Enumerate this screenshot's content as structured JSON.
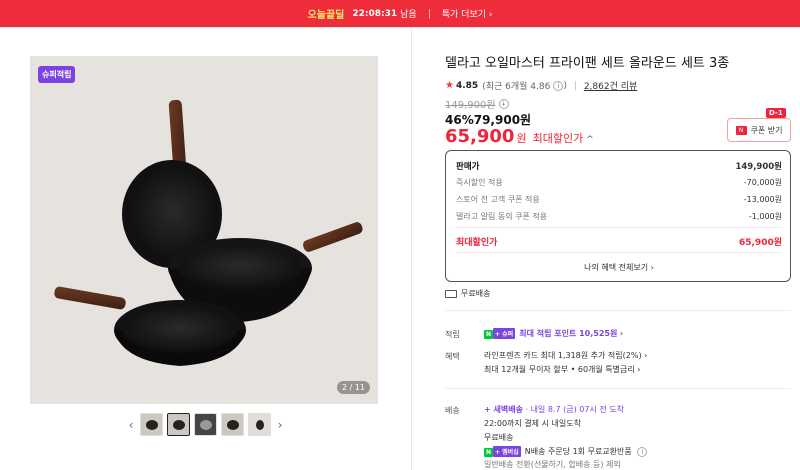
{
  "topbar": {
    "deal_label": "오늘끝딜",
    "timer": "22:08:31",
    "timer_suffix": "남음",
    "more_label": "특가 더보기 ›"
  },
  "gallery": {
    "badge": "슈퍼적립",
    "counter": "2 / 11",
    "prev_icon": "chevron-left-icon",
    "next_icon": "chevron-right-icon"
  },
  "product": {
    "title": "델라고 오일마스터 프라이팬 세트 올라운드 세트 3종",
    "rating": "4.85",
    "rating_sub": "(최근 6개월 4.86",
    "rating_sub_close": ")",
    "reviews": "2,862건 리뷰",
    "original_price": "149,900원",
    "discount_rate": "46%",
    "sale_price": "79,900원",
    "max_price": "65,900",
    "max_unit": "원",
    "max_label": "최대할인가",
    "coupon_label": "쿠폰 받기",
    "coupon_dday": "D-1"
  },
  "breakdown": {
    "rows": [
      {
        "k": "판매가",
        "v": "149,900원"
      },
      {
        "k": "즉시할인 적용",
        "v": "-70,000원"
      },
      {
        "k": "스토어 전 고객 쿠폰 적용",
        "v": "-13,000원"
      },
      {
        "k": "델라고 알림 동의 쿠폰 적용",
        "v": "-1,000원"
      }
    ],
    "total_label": "최대할인가",
    "total_value": "65,900원",
    "footer_link": "나의 혜택 전체보기 ›"
  },
  "shipping_free": "무료배송",
  "benefits": {
    "reward_label": "적립",
    "npay_tag": "N",
    "plus_tag": "+ 슈퍼",
    "reward_text": "최대 적립 포인트 10,525원",
    "reward_chevron": "›",
    "benefit_label": "혜택",
    "benefit_line1": "라인프렌즈 카드 최대 1,318원 추가 적립(2%) ›",
    "benefit_line2": "최대 12개월 무이자 할부 • 60개월 특별금리 ›"
  },
  "delivery": {
    "label": "배송",
    "tag": "+ 새벽배송",
    "date": "· 내일 8.7 (금) 07시 전 도착",
    "cutoff": "22:00까지 결제 시 내일도착",
    "free": "무료배송",
    "npay_tag": "N",
    "membership_tag": "+ 멤버십",
    "return_text": "N배송 주문당 1회 무료교환반품",
    "general": "일반배송 전환(선물하기, 합배송 등) 제외"
  },
  "colors": {
    "brand_red": "#ef2d3a",
    "price_red": "#f0233a",
    "super_purple": "#7b44e0",
    "npay_green": "#00c73c"
  }
}
